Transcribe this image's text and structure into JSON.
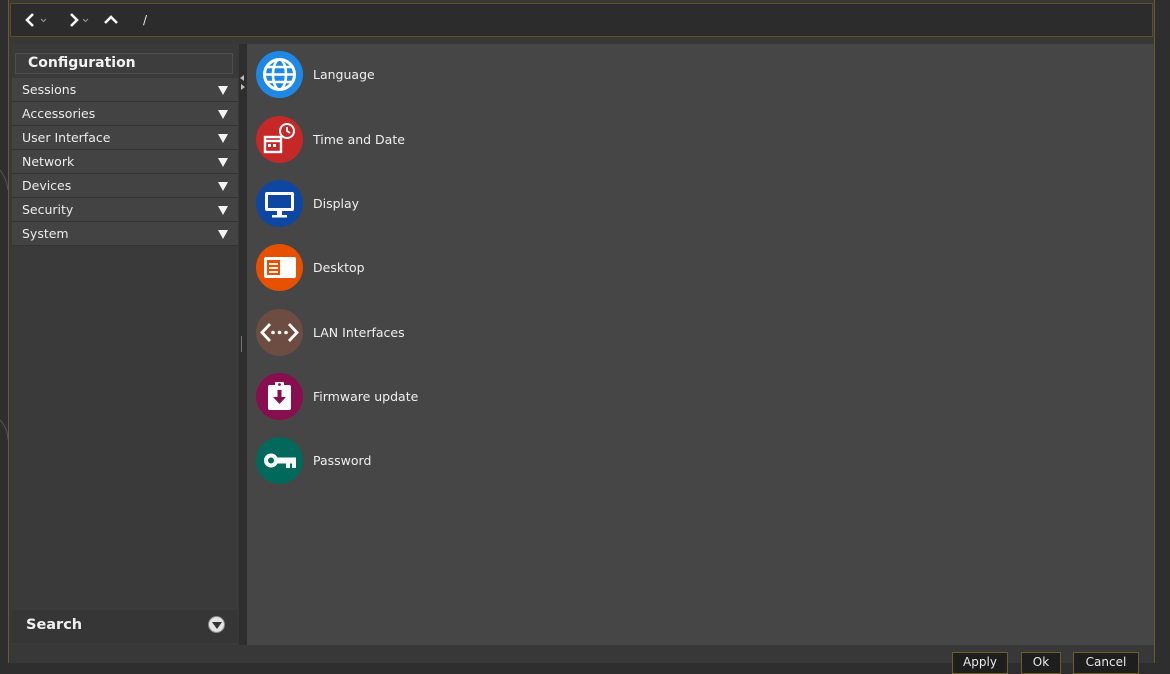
{
  "toolbar": {
    "back_icon": "chevron-left-icon",
    "forward_icon": "chevron-right-icon",
    "up_icon": "chevron-up-icon",
    "path": "/"
  },
  "sidebar": {
    "title": "Configuration",
    "categories": [
      {
        "label": "Sessions"
      },
      {
        "label": "Accessories"
      },
      {
        "label": "User Interface"
      },
      {
        "label": "Network"
      },
      {
        "label": "Devices"
      },
      {
        "label": "Security"
      },
      {
        "label": "System"
      }
    ],
    "search_label": "Search"
  },
  "modules": [
    {
      "label": "Language",
      "icon": "globe-icon",
      "color": "#1e88e5"
    },
    {
      "label": "Time and Date",
      "icon": "calendar-clock-icon",
      "color": "#c62828"
    },
    {
      "label": "Display",
      "icon": "monitor-icon",
      "color": "#0d47a1"
    },
    {
      "label": "Desktop",
      "icon": "desktop-icon",
      "color": "#e65100"
    },
    {
      "label": "LAN Interfaces",
      "icon": "network-icon",
      "color": "#6d4c41"
    },
    {
      "label": "Firmware update",
      "icon": "firmware-download-icon",
      "color": "#880e4f"
    },
    {
      "label": "Password",
      "icon": "key-icon",
      "color": "#00695c"
    }
  ],
  "footer": {
    "apply_label": "Apply",
    "ok_label": "Ok",
    "cancel_label": "Cancel"
  },
  "colors": {
    "accent_border": "#6d5d2a",
    "background": "#464646"
  }
}
